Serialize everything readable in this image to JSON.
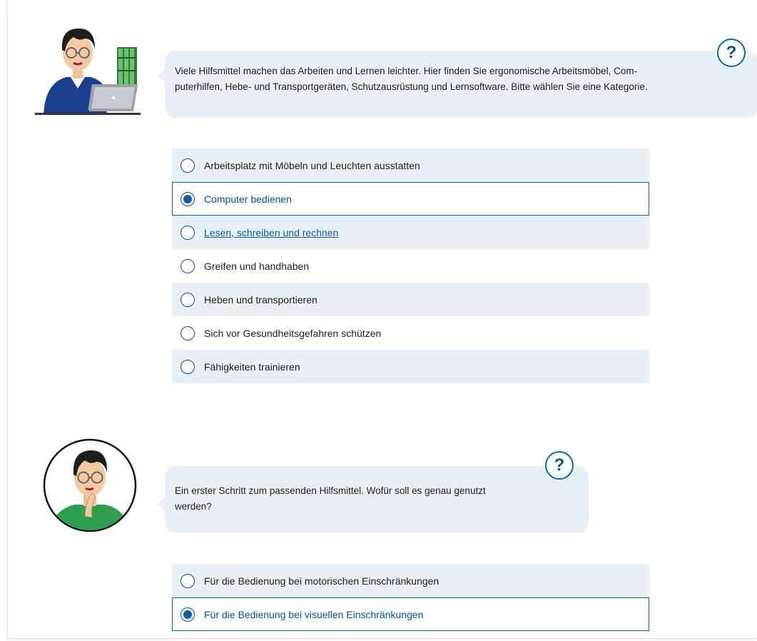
{
  "section1": {
    "question": "Viele Hilfsmittel machen das Arbeiten und Lernen leichter. Hier finden Sie ergonomische Arbeitsmöbel, Com-puterhilfen, Hebe- und Transportgeräten, Schutzausrüstung und Lernsoftware. Bitte wählen Sie eine Kategorie.",
    "question_line1": "Viele Hilfsmittel machen das Arbeiten und Lernen leichter. Hier finden Sie ergonomische Arbeitsmöbel, Com-",
    "question_line2": "puterhilfen, Hebe- und Transportgeräten, Schutzausrüstung und Lernsoftware. Bitte wählen Sie eine Kategorie.",
    "help_label": "?",
    "options": [
      {
        "label": "Arbeitsplatz mit Möbeln und Leuchten ausstatten",
        "selected": false
      },
      {
        "label": "Computer bedienen",
        "selected": true
      },
      {
        "label": "Lesen, schreiben und rechnen",
        "selected": false,
        "hovered": true
      },
      {
        "label": "Greifen und handhaben",
        "selected": false
      },
      {
        "label": "Heben und transportieren",
        "selected": false
      },
      {
        "label": "Sich vor Gesundheitsgefahren schützen",
        "selected": false
      },
      {
        "label": "Fähigkeiten trainieren",
        "selected": false
      }
    ]
  },
  "section2": {
    "question_line1": "Ein erster Schritt zum passenden Hilfsmittel. Wofür soll es genau genutzt",
    "question_line2": "werden?",
    "help_label": "?",
    "options": [
      {
        "label": "Für die Bedienung bei motorischen Einschränkungen",
        "selected": false
      },
      {
        "label": "Für die Bedienung bei visuellen Einschränkungen",
        "selected": true
      }
    ]
  },
  "colors": {
    "accent": "#0d5ea0",
    "bubble_bg": "#e8f0f6",
    "option_shade": "#e9f0f5",
    "selected_border": "#0d6aa8"
  },
  "icons": {
    "avatar1": "woman-at-laptop-illustration",
    "avatar2": "thinking-woman-portrait",
    "help": "question-mark-icon"
  }
}
